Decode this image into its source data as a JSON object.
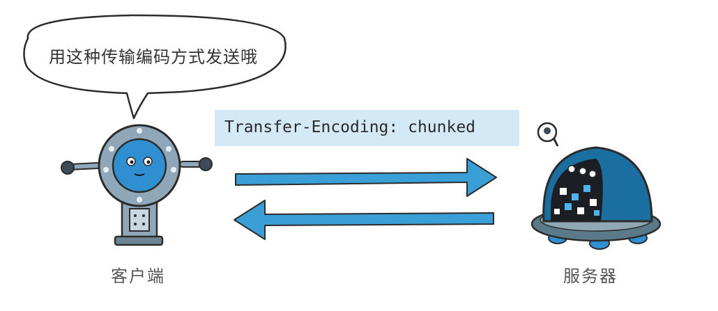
{
  "speech_bubble": {
    "text": "用这种传输编码方式发送哦"
  },
  "header": {
    "text": "Transfer-Encoding: chunked"
  },
  "client": {
    "label": "客户端"
  },
  "server": {
    "label": "服务器"
  },
  "colors": {
    "arrow": "#3a9fd6",
    "header_box": "#d3e9f6",
    "robot_head": "#8fa7b8",
    "robot_face": "#2f8fd0",
    "server_dome": "#1a6fa0",
    "server_base": "#5a7a8a",
    "outline": "#2b2b2b"
  },
  "icons": [
    "client-robot-icon",
    "server-robot-icon",
    "arrow-right-icon",
    "arrow-left-icon"
  ]
}
